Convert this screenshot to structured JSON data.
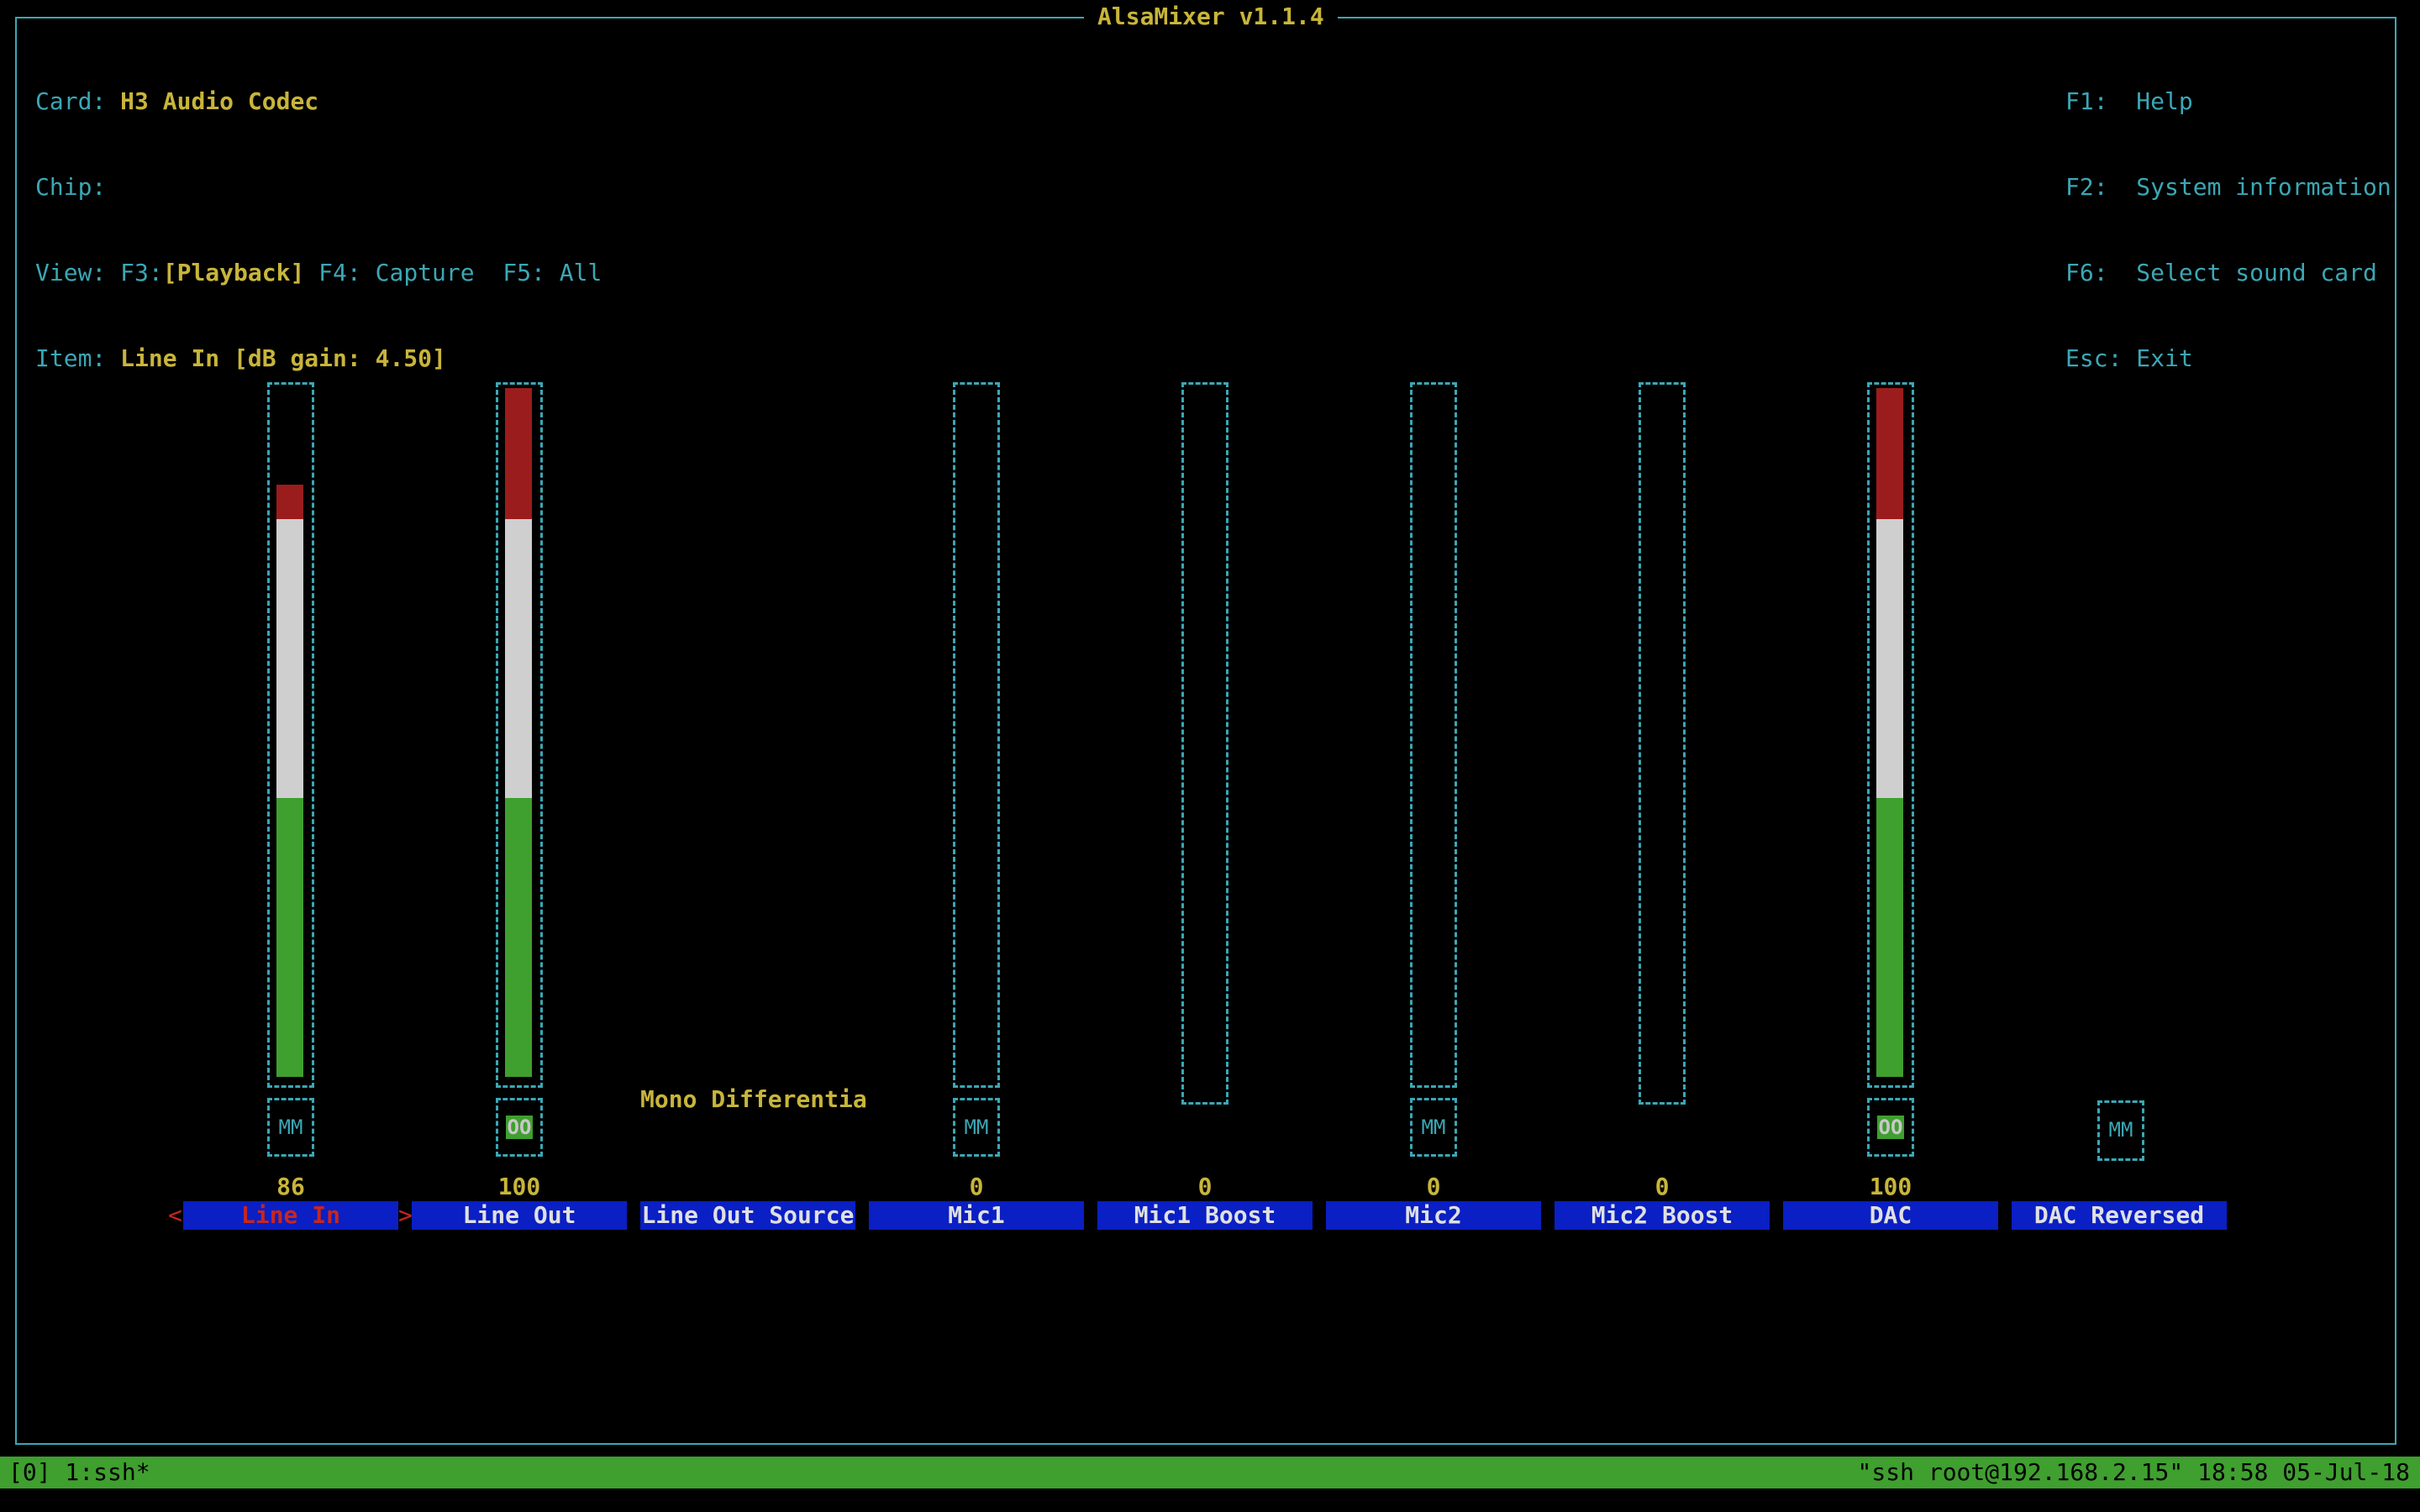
{
  "title": "AlsaMixer v1.1.4",
  "info": {
    "card_label": "Card:",
    "card_value": "H3 Audio Codec",
    "chip_label": "Chip:",
    "chip_value": "",
    "view_label": "View:",
    "view_f3": "F3:",
    "view_playback": "[Playback]",
    "view_f4": "F4:",
    "view_capture": "Capture",
    "view_f5": "F5:",
    "view_all": "All",
    "item_label": "Item:",
    "item_value": "Line In [dB gain: 4.50]"
  },
  "keys": [
    "F1:  Help",
    "F2:  System information",
    "F6:  Select sound card",
    "Esc: Exit"
  ],
  "channels": [
    {
      "name": "Line In",
      "volume": "86",
      "level": 0.86,
      "mute": "MM",
      "active": true
    },
    {
      "name": "Line Out",
      "volume": "100",
      "level": 1.0,
      "mute": "OO",
      "active": false
    },
    {
      "name": "Line Out Source",
      "enum_value": "Mono Differentia"
    },
    {
      "name": "Mic1",
      "volume": "0",
      "level": 0,
      "mute": "MM"
    },
    {
      "name": "Mic1 Boost",
      "volume": "0",
      "level": 0
    },
    {
      "name": "Mic2",
      "volume": "0",
      "level": 0,
      "mute": "MM"
    },
    {
      "name": "Mic2 Boost",
      "volume": "0",
      "level": 0
    },
    {
      "name": "DAC",
      "volume": "100",
      "level": 1.0,
      "mute": "OO"
    },
    {
      "name": "DAC Reversed",
      "mute": "MM"
    }
  ],
  "selection_arrows": {
    "left": "<",
    "right": ">"
  },
  "status_bar": {
    "left": "[0] 1:ssh*",
    "right": "\"ssh root@192.168.2.15\" 18:58 05-Jul-18"
  },
  "colors": {
    "border": "#3ba7b5",
    "highlight": "#c8b53a",
    "level_red": "#9b1c1c",
    "level_white": "#cfcfcf",
    "level_green": "#3f9f2f",
    "name_bg": "#0a1fc4",
    "status_bg": "#3f9f2f"
  }
}
